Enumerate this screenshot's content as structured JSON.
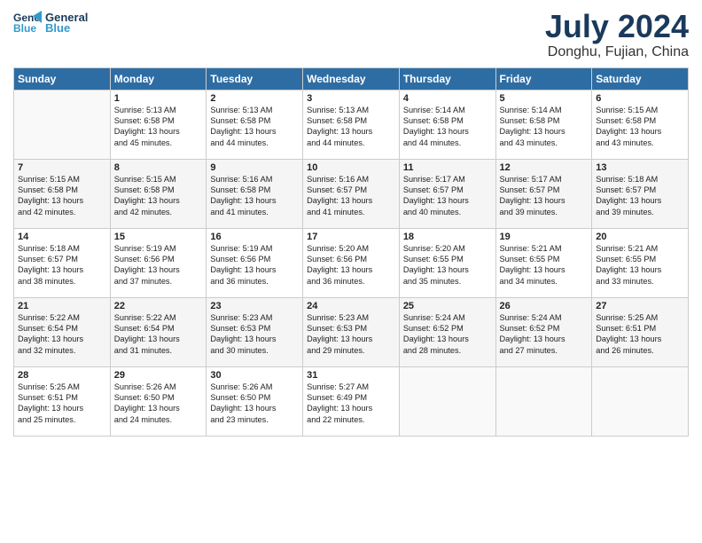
{
  "header": {
    "logo_general": "General",
    "logo_blue": "Blue",
    "month_title": "July 2024",
    "subtitle": "Donghu, Fujian, China"
  },
  "columns": [
    "Sunday",
    "Monday",
    "Tuesday",
    "Wednesday",
    "Thursday",
    "Friday",
    "Saturday"
  ],
  "weeks": [
    [
      {
        "day": "",
        "text": ""
      },
      {
        "day": "1",
        "text": "Sunrise: 5:13 AM\nSunset: 6:58 PM\nDaylight: 13 hours\nand 45 minutes."
      },
      {
        "day": "2",
        "text": "Sunrise: 5:13 AM\nSunset: 6:58 PM\nDaylight: 13 hours\nand 44 minutes."
      },
      {
        "day": "3",
        "text": "Sunrise: 5:13 AM\nSunset: 6:58 PM\nDaylight: 13 hours\nand 44 minutes."
      },
      {
        "day": "4",
        "text": "Sunrise: 5:14 AM\nSunset: 6:58 PM\nDaylight: 13 hours\nand 44 minutes."
      },
      {
        "day": "5",
        "text": "Sunrise: 5:14 AM\nSunset: 6:58 PM\nDaylight: 13 hours\nand 43 minutes."
      },
      {
        "day": "6",
        "text": "Sunrise: 5:15 AM\nSunset: 6:58 PM\nDaylight: 13 hours\nand 43 minutes."
      }
    ],
    [
      {
        "day": "7",
        "text": "Sunrise: 5:15 AM\nSunset: 6:58 PM\nDaylight: 13 hours\nand 42 minutes."
      },
      {
        "day": "8",
        "text": "Sunrise: 5:15 AM\nSunset: 6:58 PM\nDaylight: 13 hours\nand 42 minutes."
      },
      {
        "day": "9",
        "text": "Sunrise: 5:16 AM\nSunset: 6:58 PM\nDaylight: 13 hours\nand 41 minutes."
      },
      {
        "day": "10",
        "text": "Sunrise: 5:16 AM\nSunset: 6:57 PM\nDaylight: 13 hours\nand 41 minutes."
      },
      {
        "day": "11",
        "text": "Sunrise: 5:17 AM\nSunset: 6:57 PM\nDaylight: 13 hours\nand 40 minutes."
      },
      {
        "day": "12",
        "text": "Sunrise: 5:17 AM\nSunset: 6:57 PM\nDaylight: 13 hours\nand 39 minutes."
      },
      {
        "day": "13",
        "text": "Sunrise: 5:18 AM\nSunset: 6:57 PM\nDaylight: 13 hours\nand 39 minutes."
      }
    ],
    [
      {
        "day": "14",
        "text": "Sunrise: 5:18 AM\nSunset: 6:57 PM\nDaylight: 13 hours\nand 38 minutes."
      },
      {
        "day": "15",
        "text": "Sunrise: 5:19 AM\nSunset: 6:56 PM\nDaylight: 13 hours\nand 37 minutes."
      },
      {
        "day": "16",
        "text": "Sunrise: 5:19 AM\nSunset: 6:56 PM\nDaylight: 13 hours\nand 36 minutes."
      },
      {
        "day": "17",
        "text": "Sunrise: 5:20 AM\nSunset: 6:56 PM\nDaylight: 13 hours\nand 36 minutes."
      },
      {
        "day": "18",
        "text": "Sunrise: 5:20 AM\nSunset: 6:55 PM\nDaylight: 13 hours\nand 35 minutes."
      },
      {
        "day": "19",
        "text": "Sunrise: 5:21 AM\nSunset: 6:55 PM\nDaylight: 13 hours\nand 34 minutes."
      },
      {
        "day": "20",
        "text": "Sunrise: 5:21 AM\nSunset: 6:55 PM\nDaylight: 13 hours\nand 33 minutes."
      }
    ],
    [
      {
        "day": "21",
        "text": "Sunrise: 5:22 AM\nSunset: 6:54 PM\nDaylight: 13 hours\nand 32 minutes."
      },
      {
        "day": "22",
        "text": "Sunrise: 5:22 AM\nSunset: 6:54 PM\nDaylight: 13 hours\nand 31 minutes."
      },
      {
        "day": "23",
        "text": "Sunrise: 5:23 AM\nSunset: 6:53 PM\nDaylight: 13 hours\nand 30 minutes."
      },
      {
        "day": "24",
        "text": "Sunrise: 5:23 AM\nSunset: 6:53 PM\nDaylight: 13 hours\nand 29 minutes."
      },
      {
        "day": "25",
        "text": "Sunrise: 5:24 AM\nSunset: 6:52 PM\nDaylight: 13 hours\nand 28 minutes."
      },
      {
        "day": "26",
        "text": "Sunrise: 5:24 AM\nSunset: 6:52 PM\nDaylight: 13 hours\nand 27 minutes."
      },
      {
        "day": "27",
        "text": "Sunrise: 5:25 AM\nSunset: 6:51 PM\nDaylight: 13 hours\nand 26 minutes."
      }
    ],
    [
      {
        "day": "28",
        "text": "Sunrise: 5:25 AM\nSunset: 6:51 PM\nDaylight: 13 hours\nand 25 minutes."
      },
      {
        "day": "29",
        "text": "Sunrise: 5:26 AM\nSunset: 6:50 PM\nDaylight: 13 hours\nand 24 minutes."
      },
      {
        "day": "30",
        "text": "Sunrise: 5:26 AM\nSunset: 6:50 PM\nDaylight: 13 hours\nand 23 minutes."
      },
      {
        "day": "31",
        "text": "Sunrise: 5:27 AM\nSunset: 6:49 PM\nDaylight: 13 hours\nand 22 minutes."
      },
      {
        "day": "",
        "text": ""
      },
      {
        "day": "",
        "text": ""
      },
      {
        "day": "",
        "text": ""
      }
    ]
  ]
}
